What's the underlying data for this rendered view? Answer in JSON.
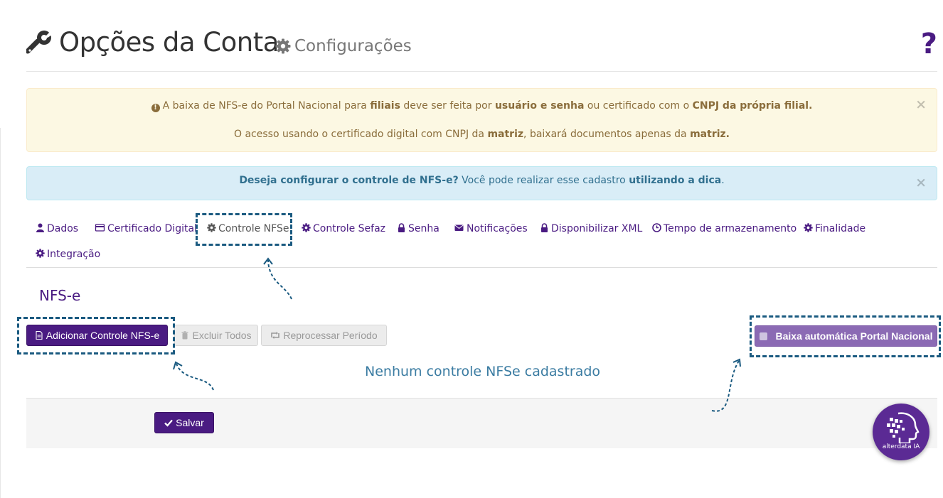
{
  "header": {
    "title": "Opções da Conta",
    "subtitle": "Configurações",
    "help_label": "?"
  },
  "alerts": {
    "warning": {
      "p1": "A baixa de NFS-e do Portal Nacional para ",
      "b1": "filiais",
      "p2": " deve ser feita por ",
      "b2": "usuário e senha",
      "p3": " ou certificado com o ",
      "b3": "CNPJ da própria filial.",
      "p4": "O acesso usando o certificado digital com CNPJ da ",
      "b4": "matriz",
      "p5": ", baixará documentos apenas da ",
      "b5": "matriz.",
      "close": "×"
    },
    "info": {
      "b1": "Deseja configurar o controle de NFS-e?",
      "p1": " Você pode realizar esse cadastro ",
      "b2": "utilizando a dica",
      "p2": ".",
      "close": "×"
    }
  },
  "tabs": [
    {
      "label": "Dados",
      "icon": "user-icon"
    },
    {
      "label": "Certificado Digital",
      "icon": "credit-card-icon"
    },
    {
      "label": "Controle NFSe",
      "icon": "gear-icon",
      "active": true
    },
    {
      "label": "Controle Sefaz",
      "icon": "gear-icon"
    },
    {
      "label": "Senha",
      "icon": "lock-icon"
    },
    {
      "label": "Notificações",
      "icon": "envelope-icon"
    },
    {
      "label": "Disponibilizar XML",
      "icon": "lock-icon"
    },
    {
      "label": "Tempo de armazenamento",
      "icon": "clock-icon"
    },
    {
      "label": "Finalidade",
      "icon": "gear-icon"
    },
    {
      "label": "Integração",
      "icon": "gear-icon"
    }
  ],
  "section": {
    "title": "NFS-e",
    "empty_message": "Nenhum controle NFSe cadastrado"
  },
  "buttons": {
    "add": "Adicionar Controle NFS-e",
    "delete_all": "Excluir Todos",
    "reprocess": "Reprocessar Período",
    "auto_download": "Baixa automática Portal Nacional",
    "save": "Salvar"
  },
  "ai_badge": {
    "label": "alterdata IA"
  },
  "colors": {
    "brand_purple": "#4a1b82",
    "auto_button": "#8b6ab4",
    "warning_bg": "#fcf8e3",
    "info_bg": "#d9edf7",
    "highlight": "#1a5a80"
  }
}
